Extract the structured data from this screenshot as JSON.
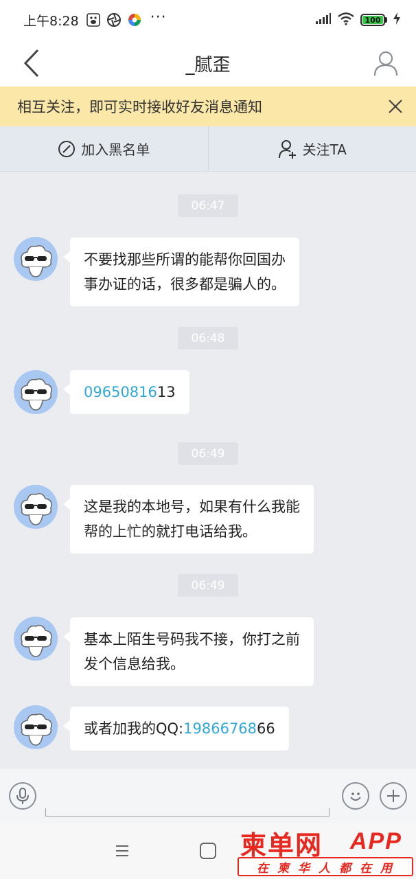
{
  "status_bar": {
    "time": "上午8:28",
    "more": "···",
    "battery": "100",
    "icons": [
      "baidu-icon",
      "aperture-icon",
      "colorful-app-icon",
      "signal-icon",
      "wifi-icon",
      "battery-icon",
      "charging-icon"
    ]
  },
  "header": {
    "title": "_腻歪",
    "back_icon": "chevron-left-icon",
    "profile_icon": "user-icon"
  },
  "notice": {
    "text": "相互关注，即可实时接收好友消息通知",
    "close_icon": "close-icon",
    "background": "#fbe8a8"
  },
  "actions": {
    "block_label": "加入黑名单",
    "follow_label": "关注TA"
  },
  "messages": [
    {
      "time": "06:47",
      "line1": "不要找那些所谓的能帮你回国办",
      "line2": "事办证的话，很多都是骗人的。"
    },
    {
      "time": "06:48",
      "link": "09650816",
      "rest": "13"
    },
    {
      "time": "06:49",
      "line1": "这是我的本地号，如果有什么我能",
      "line2": "帮的上忙的就打电话给我。"
    },
    {
      "time": "06:49",
      "line1": "基本上陌生号码我不接，你打之前",
      "line2": "发个信息给我。"
    },
    {
      "prefix": "或者加我的QQ:",
      "link": "19866768",
      "rest": "66"
    }
  ],
  "watermark": {
    "title": "柬单网",
    "app": "APP",
    "slogan": "在柬华人都在用"
  },
  "colors": {
    "link": "#2fa8d8",
    "watermark": "#e8281e",
    "chat_bg": "#ebecf0"
  }
}
